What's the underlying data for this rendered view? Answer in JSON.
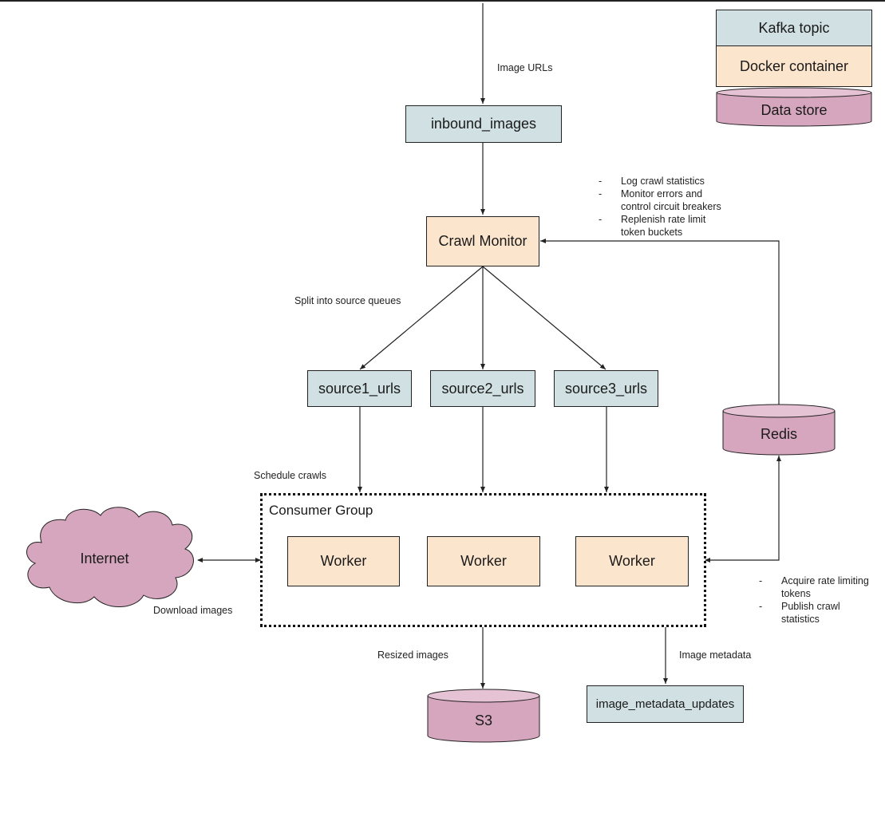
{
  "legend": {
    "kafka": "Kafka topic",
    "docker": "Docker container",
    "store": "Data store"
  },
  "colors": {
    "kafka": "#d0e0e3",
    "docker": "#fce5cd",
    "store": "#d5a6bd",
    "store_top": "#e6c3d4",
    "stroke": "#222222"
  },
  "nodes": {
    "inbound": "inbound_images",
    "crawl_monitor": "Crawl Monitor",
    "source1": "source1_urls",
    "source2": "source2_urls",
    "source3": "source3_urls",
    "redis": "Redis",
    "consumer_group": "Consumer Group",
    "workers": [
      "Worker",
      "Worker",
      "Worker"
    ],
    "internet": "Internet",
    "s3": "S3",
    "metadata": "image_metadata_updates"
  },
  "edge_labels": {
    "image_urls": "Image URLs",
    "split": "Split into source queues",
    "schedule": "Schedule crawls",
    "download": "Download images",
    "resized": "Resized images",
    "metadata": "Image metadata"
  },
  "notes": {
    "monitor": [
      {
        "bullet": "-",
        "text": "Log crawl statistics"
      },
      {
        "bullet": "-",
        "text": "Monitor errors and"
      },
      {
        "bullet": "",
        "text": "control circuit breakers"
      },
      {
        "bullet": "-",
        "text": "Replenish rate limit"
      },
      {
        "bullet": "",
        "text": "token buckets"
      }
    ],
    "workers": [
      {
        "bullet": "-",
        "text": "Acquire rate limiting"
      },
      {
        "bullet": "",
        "text": "tokens"
      },
      {
        "bullet": "-",
        "text": "Publish crawl"
      },
      {
        "bullet": "",
        "text": "statistics"
      }
    ]
  }
}
